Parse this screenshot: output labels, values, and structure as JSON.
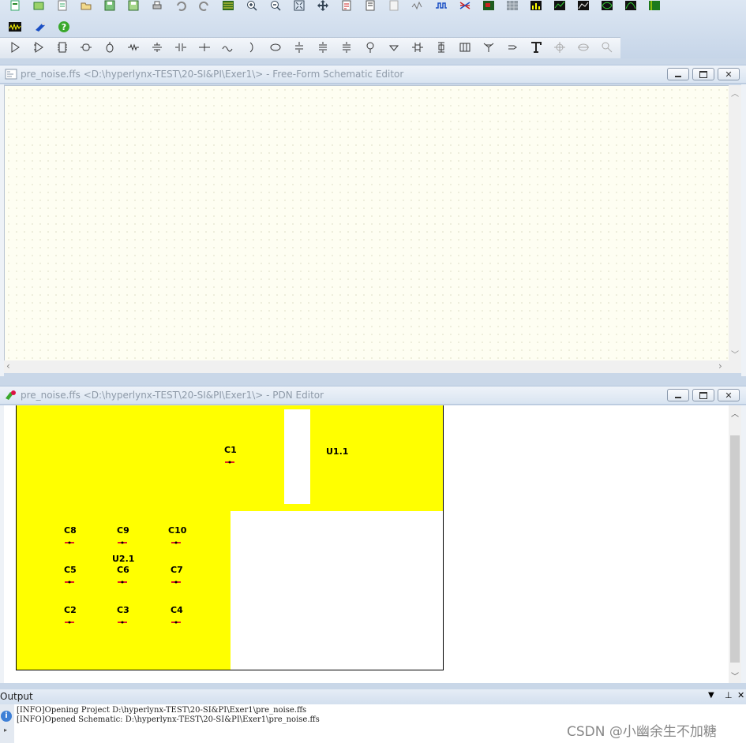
{
  "toolbar1": {
    "icons": [
      "new-schematic-icon",
      "open-schematic-icon",
      "new-board-icon",
      "open-file-icon",
      "save-icon",
      "save-as-icon",
      "print-icon",
      "undo-icon",
      "redo-icon",
      "board-viewer-icon",
      "zoom-in-icon",
      "zoom-out-icon",
      "zoom-fit-icon",
      "pan-icon",
      "report-icon",
      "netlist-icon",
      "document-icon",
      "waveform-probe-icon",
      "oscilloscope-icon",
      "stackup-icon",
      "board-3d-icon",
      "layer-grid-icon",
      "bar-chart-icon",
      "sweep-icon",
      "plot-icon",
      "eye-diagram-icon",
      "spectrum-icon",
      "pdn-icon"
    ]
  },
  "toolbar2": {
    "icons": [
      "run-simulation-icon",
      "terminator-wizard-icon",
      "help-icon"
    ]
  },
  "toolbar3": {
    "icons": [
      "buffer-icon",
      "ibis-buffer-icon",
      "ic-icon",
      "connector-icon",
      "package-icon",
      "resistor-icon",
      "capacitor-icon",
      "inductor-icon",
      "ground-cap-icon",
      "ferrite-icon",
      "coupler-icon",
      "via-icon",
      "stackup-line-icon",
      "differential-line-icon",
      "probe-point-icon",
      "ground-icon",
      "series-term-icon",
      "split-icon",
      "cable-icon",
      "bus-icon",
      "y-junction-icon",
      "flag-icon",
      "text-tool-icon",
      "crosshair-icon",
      "swap-icon",
      "measure-icon"
    ]
  },
  "schematic_window": {
    "title": "pre_noise.ffs <D:\\hyperlynx-TEST\\20-SI&PI\\Exer1\\> - Free-Form Schematic Editor"
  },
  "pdn_window": {
    "title": "pre_noise.ffs <D:\\hyperlynx-TEST\\20-SI&PI\\Exer1\\> - PDN Editor",
    "components": [
      {
        "ref": "C1",
        "kind": "cap"
      },
      {
        "ref": "U1.1",
        "kind": "ic"
      },
      {
        "ref": "C8",
        "kind": "cap"
      },
      {
        "ref": "C9",
        "kind": "cap"
      },
      {
        "ref": "C10",
        "kind": "cap"
      },
      {
        "ref": "U2.1",
        "kind": "ic"
      },
      {
        "ref": "C5",
        "kind": "cap"
      },
      {
        "ref": "C6",
        "kind": "cap"
      },
      {
        "ref": "C7",
        "kind": "cap"
      },
      {
        "ref": "C2",
        "kind": "cap"
      },
      {
        "ref": "C3",
        "kind": "cap"
      },
      {
        "ref": "C4",
        "kind": "cap"
      }
    ],
    "colors": {
      "plane": "#ffff00",
      "cap_marker": "#e02020"
    }
  },
  "output_panel": {
    "title": "Output",
    "lines": [
      "[INFO]Opening Project D:\\hyperlynx-TEST\\20-SI&PI\\Exer1\\pre_noise.ffs",
      "[INFO]Opened Schematic: D:\\hyperlynx-TEST\\20-SI&PI\\Exer1\\pre_noise.ffs"
    ]
  },
  "watermark": "CSDN @小幽余生不加糖"
}
